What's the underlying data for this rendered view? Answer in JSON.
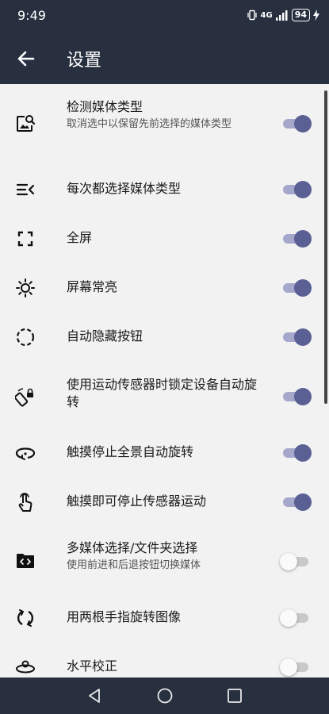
{
  "status_bar": {
    "time": "9:49",
    "network": "4G",
    "battery": "94"
  },
  "app_bar": {
    "title": "设置",
    "back_icon": "arrow-back-icon"
  },
  "settings": [
    {
      "title": "检测媒体类型",
      "subtitle": "取消选中以保留先前选择的媒体类型",
      "enabled": true,
      "icon": "image-search-icon"
    },
    {
      "title": "每次都选择媒体类型",
      "enabled": true,
      "icon": "list-collapse-icon"
    },
    {
      "title": "全屏",
      "enabled": true,
      "icon": "fullscreen-icon"
    },
    {
      "title": "屏幕常亮",
      "enabled": true,
      "icon": "brightness-icon"
    },
    {
      "title": "自动隐藏按钮",
      "enabled": true,
      "icon": "dashed-circle-icon"
    },
    {
      "title": "使用运动传感器时锁定设备自动旋转",
      "enabled": true,
      "icon": "screen-lock-rotation-icon"
    },
    {
      "title": "触摸停止全景自动旋转",
      "enabled": true,
      "icon": "panorama-rotate-icon"
    },
    {
      "title": "触摸即可停止传感器运动",
      "enabled": true,
      "icon": "touch-icon"
    },
    {
      "title": "多媒体选择/文件夹选择",
      "subtitle": "使用前进和后退按钮切换媒体",
      "enabled": false,
      "icon": "folder-code-icon"
    },
    {
      "title": "用两根手指旋转图像",
      "enabled": false,
      "icon": "rotate-icon"
    },
    {
      "title": "水平校正",
      "enabled": false,
      "icon": "horizon-icon"
    }
  ],
  "colors": {
    "bar": "#283040",
    "toggle_on_thumb": "#5a5f94",
    "toggle_on_track": "#a5a8ca"
  }
}
